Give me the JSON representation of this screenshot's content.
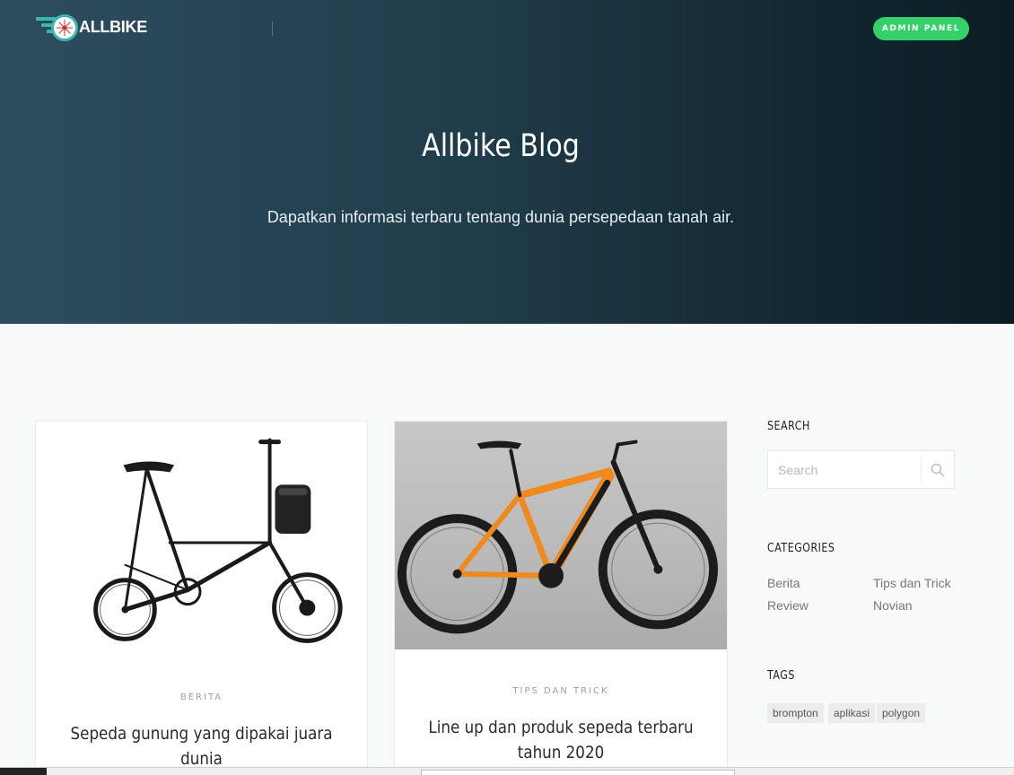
{
  "header": {
    "logo_text": "ALLBIKE",
    "admin_label": "ADMIN PANEL",
    "accent_color": "#35d06a"
  },
  "hero": {
    "title": "Allbike Blog",
    "subtitle": "Dapatkan informasi terbaru tentang dunia persepedaan tanah air."
  },
  "posts": [
    {
      "category": "BERITA",
      "title": "Sepeda gunung yang dipakai juara dunia",
      "image_icon": "folding-bike-image"
    },
    {
      "category": "TIPS DAN TRICK",
      "title": "Line up dan produk sepeda terbaru tahun 2020",
      "image_icon": "mountain-ebike-image"
    }
  ],
  "sidebar": {
    "search": {
      "heading": "SEARCH",
      "placeholder": "Search",
      "value": ""
    },
    "categories": {
      "heading": "CATEGORIES",
      "items": [
        "Berita",
        "Tips dan Trick",
        "Review",
        "Novian"
      ]
    },
    "tags": {
      "heading": "TAGS",
      "items": [
        "brompton",
        "aplikasi",
        "polygon"
      ]
    }
  }
}
